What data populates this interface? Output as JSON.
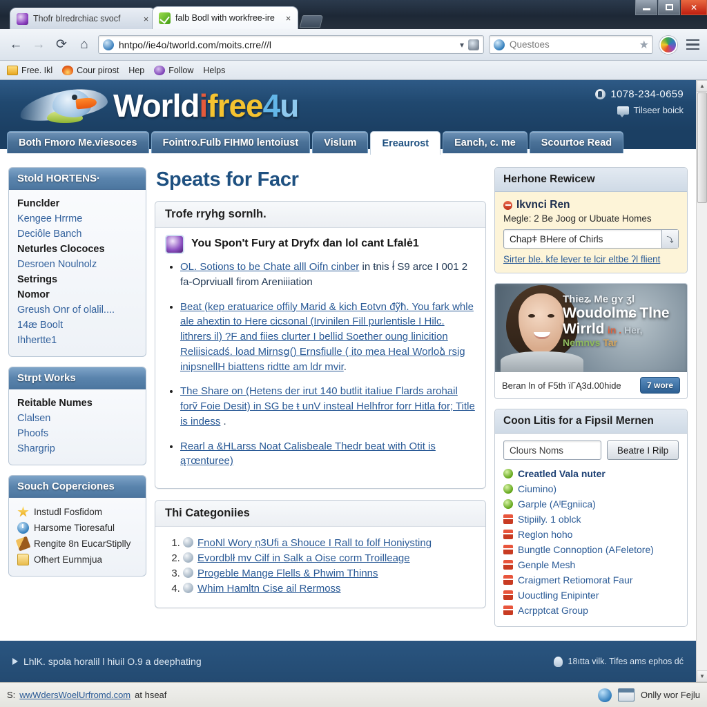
{
  "browser": {
    "tabs": [
      {
        "title": "Thofr blredrchiac svocf",
        "favicon": "purple-swirl-favicon",
        "active": false
      },
      {
        "title": "falb Bodl with workfree-ire",
        "favicon": "green-check-favicon",
        "active": true
      }
    ],
    "new_tab_label": "+",
    "close_label": "×",
    "back_icon": "back-arrow-icon",
    "forward_icon": "forward-arrow-icon",
    "reload_icon": "reload-icon",
    "home_icon": "home-icon",
    "url": "hntpo//ie4o/tworld.com/moits.crre///l",
    "url_dropdown_icon": "chevron-down-icon",
    "url_page_icon": "page-icon",
    "search_value": "Questoes",
    "search_star_icon": "star-icon",
    "profile_icon": "profile-avatar-icon",
    "menu_icon": "hamburger-menu-icon",
    "window_minimize": "–",
    "window_maximize": "□",
    "window_close": "✕",
    "bookmarks": [
      {
        "label": "Free. Ikl",
        "icon": "folder-icon"
      },
      {
        "label": "Cour pirost",
        "icon": "fire-icon"
      },
      {
        "label": "Hep",
        "icon": "none"
      },
      {
        "label": "Follow",
        "icon": "people-icon"
      },
      {
        "label": "Helps",
        "icon": "none"
      }
    ]
  },
  "site": {
    "logo": {
      "part1": "World",
      "part2": "i",
      "part3": "free",
      "part4": "4",
      "part5": "u",
      "mark": "bird-logo-icon"
    },
    "phone": "1078-234-0659",
    "phone_icon": "call-icon",
    "callback_label": "Tilseer boick",
    "callback_icon": "chat-icon",
    "nav_tabs": [
      {
        "label": "Both Fmoro Me.viesoces",
        "active": false
      },
      {
        "label": "Fointro.Fulb FIHM0 lentoiust",
        "active": false
      },
      {
        "label": "Vislum",
        "active": false
      },
      {
        "label": "Ereaurost",
        "active": true
      },
      {
        "label": "Eanch, c. me",
        "active": false
      },
      {
        "label": "Scourtoe Read",
        "active": false
      }
    ]
  },
  "sidebar": {
    "panels": [
      {
        "title": "Stold HORTENS·",
        "items": [
          {
            "label": "Funclder",
            "bold": true
          },
          {
            "label": "Kengee Hrrme",
            "bold": false
          },
          {
            "label": "Deciôle Banch",
            "bold": false
          },
          {
            "label": "Neturles Clococes",
            "bold": true
          },
          {
            "label": "Desroen Noulnolz",
            "bold": false
          },
          {
            "label": "Setrings",
            "bold": true
          },
          {
            "label": "Nomor",
            "bold": true
          },
          {
            "label": "Greush Onr of olalil....",
            "bold": false
          },
          {
            "label": "14æ Boolt",
            "bold": false
          },
          {
            "label": "Ihhertte1",
            "bold": false
          }
        ]
      },
      {
        "title": "Strpt Works",
        "items": [
          {
            "label": "Reitable Numes",
            "bold": true
          },
          {
            "label": "Clalsen",
            "bold": false
          },
          {
            "label": "Phoofs",
            "bold": false
          },
          {
            "label": "Shargrip",
            "bold": false
          }
        ]
      }
    ],
    "features_panel": {
      "title": "Souch Coperciones",
      "items": [
        {
          "label": "Instudl Fosfidom",
          "icon": "star-icon"
        },
        {
          "label": "Harsome Tioresaful",
          "icon": "clock-icon"
        },
        {
          "label": "Rengite 8n EucarStiplly",
          "icon": "wand-icon"
        },
        {
          "label": "Ofhert Eurnmjua",
          "icon": "folder-icon"
        }
      ]
    }
  },
  "main": {
    "page_title": "Speats for Facr",
    "panel": {
      "heading": "Trofe rryhg sornlh.",
      "lead_icon": "badge-icon",
      "lead_text": "You Spon't Fury at Dryfx đan lol cant Lfalė1",
      "bullets": [
        {
          "link": "OL. Sotions to be Chate alll Oifn cinber",
          "tail": " in ŧnis ł́ S9 arce I 001 2 fa-Oprviuall firom Areniiiation"
        },
        {
          "link": "Beat (kep eratuarice offily Marid & kich Eotvn đỹħ. You fark whle ale ahextin to Here cicsonal (Irvinilen Fill purlentisle I Hilc. lithrers il) ?F and fiies clurter I bellid Soether oung linicition Reliisicadś. load Mirnѕց() Ernsfiulle ( ito mea Heal Worloձ rsig inipsnellH biattens ridtte am ldr mvir",
          "tail": "."
        },
        {
          "link": "The Share on (Hetens der irut 140 butlit itaIiue Γlards arohail forṽ Foie Desit) in SG be ŧ unV insteal Helhfror forr Hitla for; Title is indess",
          "tail": " ."
        },
        {
          "link": "Rearl a &HLarss Noat Calisbeale Thedr beat with Otit is ąтœnturee)",
          "tail": ""
        }
      ]
    },
    "categories_panel": {
      "heading": "Thi Categoniies",
      "items": [
        {
          "num": "1",
          "icon": "globe-icon",
          "label": "FnoNl Wory ņ3Ufi a Shouce I Rall to folf Honiysting"
        },
        {
          "num": "2",
          "icon": "globe-icon",
          "label": "Evordblł mv Cilf in Salk a Oise corm Troilleage"
        },
        {
          "num": "3",
          "icon": "globe-icon",
          "label": "Progeble Mange Flells & Phwim Thinns"
        },
        {
          "num": "4",
          "icon": "globe-icon",
          "label": "Whim Hamltn Cise ail Rermoss"
        }
      ]
    }
  },
  "rightbar": {
    "review_panel": {
      "title": "Herhone Rewicew",
      "item_title": "Ikvnci Ren",
      "item_icon": "minus-circle-icon",
      "item_sub": "Megle: 2 Be Joog or Ubuate Homes",
      "select_value": "Chapǂ BHere of Chirls",
      "select_icon": "dropdown-arrow-icon",
      "link": "Sirter ble. kfe lever te lcir eltbe ʔl flient"
    },
    "ad": {
      "image_icon": "woman-portrait-image",
      "line1": "Thieʑ Me ɡʏ ʒl",
      "line2_a": "Woudolmɕ",
      "line2_b": "Tlne Wirrld",
      "line3_a": "in .",
      "line3_b": "Her,",
      "line3_c": "Nemnvs",
      "line3_d": "Tar",
      "caption": "Beran ln of F5th ïΓĄ3d.00hide",
      "button": "7 wore"
    },
    "list_panel": {
      "title": "Coon Litis for a Fipsil Mernen",
      "input_value": "Clours Noms",
      "button_label": "Beatre I Rilp",
      "items": [
        {
          "label": "Creatled Vala nuter",
          "icon": "green-dot-icon",
          "bold": true
        },
        {
          "label": "Ciumino)",
          "icon": "green-dot-icon",
          "bold": false
        },
        {
          "label": "Garple (AᴵEgniica)",
          "icon": "green-dot-icon",
          "bold": false
        },
        {
          "label": "Stipiily. 1 oblck",
          "icon": "red-book-icon",
          "bold": false
        },
        {
          "label": "Reglon hoho",
          "icon": "red-book-icon",
          "bold": false
        },
        {
          "label": "Bungtle Connoption (AFeletore)",
          "icon": "red-book-icon",
          "bold": false
        },
        {
          "label": "Genple Mesh",
          "icon": "red-book-icon",
          "bold": false
        },
        {
          "label": "Craigmert Retiomorat Faur",
          "icon": "red-book-icon",
          "bold": false
        },
        {
          "label": "Uouctling Enipinter",
          "icon": "red-book-icon",
          "bold": false
        },
        {
          "label": "Acrpptcat Group",
          "icon": "red-book-icon",
          "bold": false
        }
      ]
    }
  },
  "footer": {
    "left_icon": "play-triangle-icon",
    "left_text": "LhlK. spola horalil l hiuil O.9 a deephating",
    "right_icon": "person-icon",
    "right_text": "18ıtta vilk. Tifes ams ephos dć"
  },
  "statusbar": {
    "prefix": "S:",
    "link": "wwWdersWoelUrfromd.com",
    "suffix": "at hseaf",
    "globe_icon": "globe-icon",
    "window_icon": "window-icon",
    "right_text": "Onlly wor Fejlu"
  },
  "scrollbar": {
    "up_icon": "▲",
    "down_icon": "▼"
  },
  "colors": {
    "brand_blue": "#1b3f63",
    "header_blue": "#2e5a86",
    "accent_orange": "#e45a3b",
    "accent_yellow": "#f5c330",
    "accent_lightblue": "#63b6e8",
    "link_blue": "#2a5a96",
    "review_bg": "#fdf4d8"
  }
}
